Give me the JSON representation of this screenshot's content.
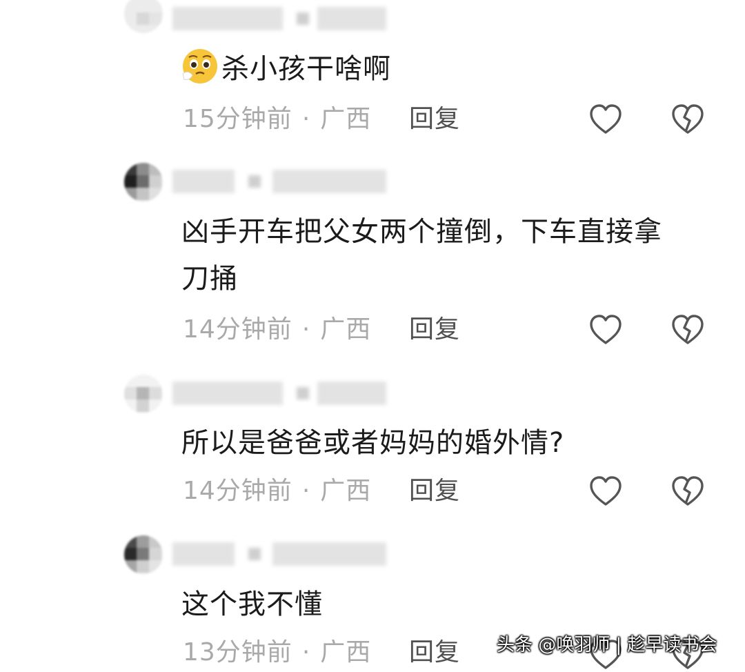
{
  "comments": [
    {
      "text": "杀小孩干啥啊",
      "time": "15分钟前",
      "separator": "·",
      "location": "广西",
      "reply_label": "回复",
      "emoji": "pleading-face-emoji"
    },
    {
      "text_line1": "凶手开车把父女两个撞倒，下车直接拿",
      "text_line2": "刀捅",
      "time": "14分钟前",
      "separator": "·",
      "location": "广西",
      "reply_label": "回复"
    },
    {
      "text": "所以是爸爸或者妈妈的婚外情?",
      "time": "14分钟前",
      "separator": "·",
      "location": "广西",
      "reply_label": "回复"
    },
    {
      "text": "这个我不懂",
      "time": "13分钟前",
      "separator": "·",
      "location": "广西",
      "reply_label": "回复"
    }
  ],
  "icons": {
    "like": "heart-outline-icon",
    "dislike": "broken-heart-icon"
  },
  "watermark": "头条 @唤羽师 | 趁早读书会",
  "colors": {
    "meta_text": "#a9a9a9",
    "reply_text": "#505050",
    "comment_text": "#1b1b1b",
    "icon_stroke": "#555555"
  }
}
